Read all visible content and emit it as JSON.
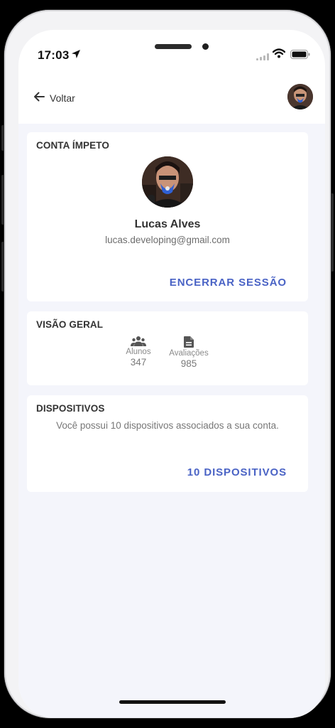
{
  "status_bar": {
    "time": "17:03",
    "icons": [
      "location-arrow-icon",
      "signal-icon",
      "wifi-icon",
      "battery-icon"
    ]
  },
  "header": {
    "back_label": "Voltar",
    "back_icon": "arrow-left-icon"
  },
  "account": {
    "title": "CONTA ÍMPETO",
    "name": "Lucas Alves",
    "email": "lucas.developing@gmail.com",
    "logout_label": "ENCERRAR SESSÃO"
  },
  "overview": {
    "title": "VISÃO GERAL",
    "stats": [
      {
        "label": "Alunos",
        "value": "347",
        "icon": "people-icon"
      },
      {
        "label": "Avaliações",
        "value": "985",
        "icon": "document-icon"
      }
    ]
  },
  "devices": {
    "title": "DISPOSITIVOS",
    "description": "Você possui 10 dispositivos associados a sua conta.",
    "button_label": "10 DISPOSITIVOS"
  },
  "colors": {
    "accent": "#4a63c5",
    "content_bg": "#f4f5fb",
    "card_bg": "#ffffff",
    "text_primary": "#333333",
    "text_secondary": "#6d6d6d"
  }
}
